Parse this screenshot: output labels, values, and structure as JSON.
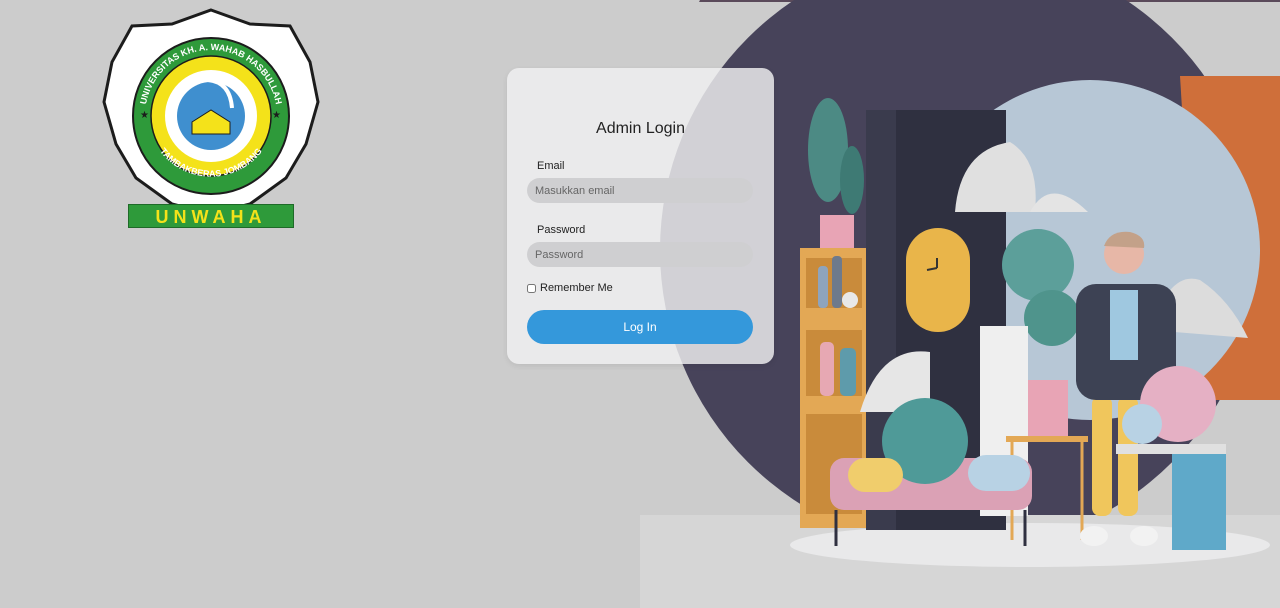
{
  "logo": {
    "ring_text_top": "UNIVERSITAS KH. A. WAHAB HASBULLAH",
    "ring_text_bottom": "TAMBAKBERAS JOMBANG",
    "banner": "UNWAHA"
  },
  "login": {
    "title": "Admin Login",
    "email_label": "Email",
    "email_placeholder": "Masukkan email",
    "password_label": "Password",
    "password_placeholder": "Password",
    "remember_label": "Remember Me",
    "submit_label": "Log In"
  },
  "colors": {
    "accent": "#3498db",
    "logo_green": "#2e9a3a",
    "logo_yellow": "#f4e21a"
  }
}
